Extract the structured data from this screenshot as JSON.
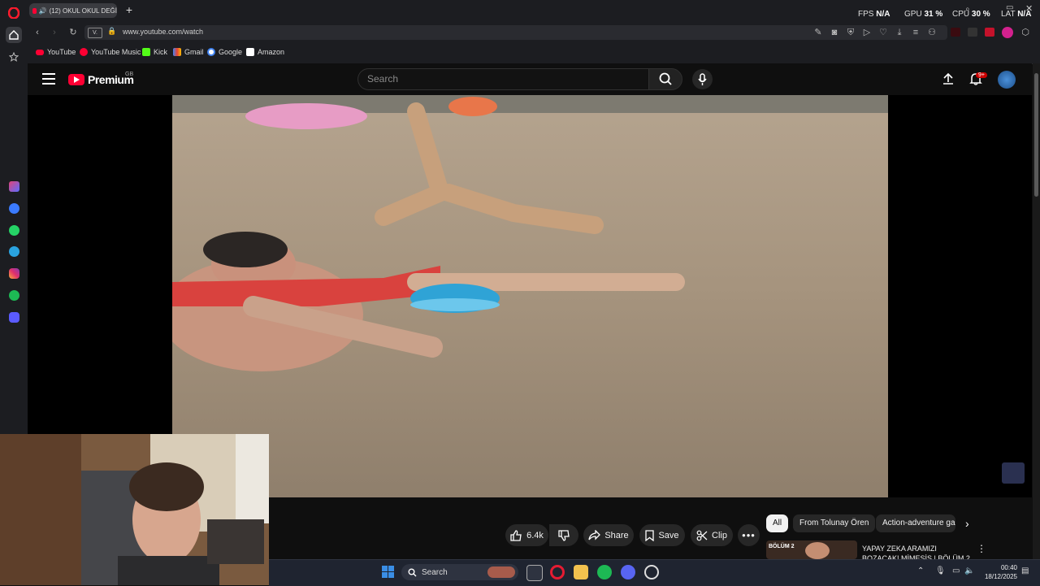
{
  "browser": {
    "tab_title": "(12) OKUL OKUL DEĞİ",
    "url": "www.youtube.com/watch",
    "hud": {
      "fps_label": "FPS",
      "fps_value": "N/A",
      "gpu_label": "GPU",
      "gpu_value": "31 %",
      "cpu_label": "CPU",
      "cpu_value": "30 %",
      "lat_label": "LAT",
      "lat_value": "N/A"
    },
    "bookmarks": [
      {
        "label": "YouTube",
        "color": "#ff0033"
      },
      {
        "label": "YouTube Music",
        "color": "#ff0033"
      },
      {
        "label": "Kick",
        "color": "#53fc18"
      },
      {
        "label": "Gmail",
        "color": "#ea4335"
      },
      {
        "label": "Google",
        "color": "#4285f4"
      },
      {
        "label": "Amazon",
        "color": "#ffffff"
      }
    ]
  },
  "youtube": {
    "brand": "Premium",
    "region": "GB",
    "search_placeholder": "Search",
    "notifications_badge": "9+",
    "actions": {
      "like_count": "6.4k",
      "share": "Share",
      "save": "Save",
      "clip": "Clip"
    },
    "chips": [
      "All",
      "From Tolunay Ören",
      "Action-adventure ga"
    ],
    "recommended": {
      "thumb_label": "BÖLÜM 2",
      "title_line1": "YAPAY ZEKA ARAMIZI",
      "title_line2": "BOZACAK! MİMESİS | BÖLÜM 2"
    }
  },
  "taskbar": {
    "search_label": "Search",
    "time": "00:40",
    "date": "18/12/2025"
  },
  "colors": {
    "yt_red": "#ff0033",
    "bg": "#0f0f0f",
    "chrome": "#1c1d21",
    "opera_red": "#ff1b2d"
  }
}
